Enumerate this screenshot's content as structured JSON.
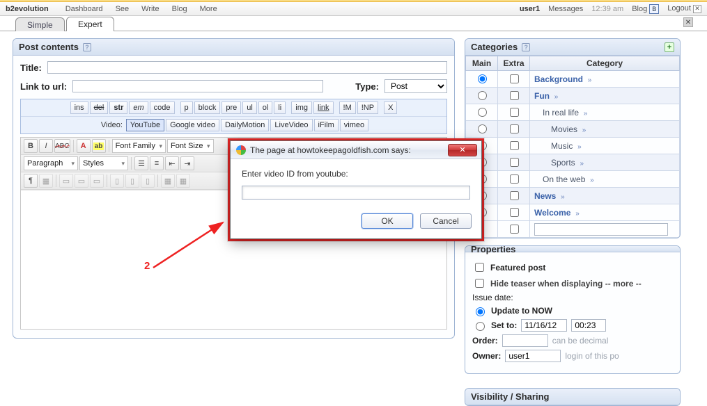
{
  "topbar": {
    "brand": "b2evolution",
    "menus": [
      "Dashboard",
      "See",
      "Write",
      "Blog",
      "More"
    ],
    "user": "user1",
    "messages": "Messages",
    "time": "12:39 am",
    "blog": "Blog",
    "logout": "Logout"
  },
  "tabs": {
    "simple": "Simple",
    "expert": "Expert"
  },
  "post": {
    "panelTitle": "Post contents",
    "titleLabel": "Title:",
    "linkLabel": "Link to url:",
    "typeLabel": "Type:",
    "typeOptions": [
      "Post"
    ],
    "typeValue": "Post",
    "tagRow1": [
      "ins",
      "del",
      "str",
      "em",
      "code",
      "p",
      "block",
      "pre",
      "ul",
      "ol",
      "li",
      "img",
      "link",
      "!M",
      "!NP",
      "X"
    ],
    "videoLabel": "Video:",
    "videoRow": [
      "YouTube",
      "Google video",
      "DailyMotion",
      "LiveVideo",
      "iFilm",
      "vimeo"
    ],
    "rte": {
      "fontFamily": "Font Family",
      "fontSize": "Font Size",
      "paragraph": "Paragraph",
      "styles": "Styles"
    }
  },
  "categories": {
    "title": "Categories",
    "headers": {
      "main": "Main",
      "extra": "Extra",
      "category": "Category"
    },
    "rows": [
      {
        "name": "Background",
        "indent": 0,
        "striped": false,
        "mainChecked": true
      },
      {
        "name": "Fun",
        "indent": 0,
        "striped": true,
        "mainChecked": false
      },
      {
        "name": "In real life",
        "indent": 1,
        "striped": false,
        "mainChecked": false
      },
      {
        "name": "Movies",
        "indent": 2,
        "striped": true,
        "mainChecked": false
      },
      {
        "name": "Music",
        "indent": 2,
        "striped": false,
        "mainChecked": false
      },
      {
        "name": "Sports",
        "indent": 2,
        "striped": true,
        "mainChecked": false
      },
      {
        "name": "On the web",
        "indent": 1,
        "striped": false,
        "mainChecked": false
      },
      {
        "name": "News",
        "indent": 0,
        "striped": true,
        "mainChecked": false
      },
      {
        "name": "Welcome",
        "indent": 0,
        "striped": false,
        "mainChecked": false
      }
    ]
  },
  "properties": {
    "title": "Properties",
    "featured": "Featured post",
    "hide": "Hide teaser when displaying -- more --",
    "issueDate": "Issue date:",
    "updateNow": "Update to NOW",
    "setTo": "Set to:",
    "date": "11/16/12",
    "time": "00:23",
    "orderLabel": "Order:",
    "orderHint": "can be decimal",
    "ownerLabel": "Owner:",
    "ownerValue": "user1",
    "ownerHint": "login of this po"
  },
  "visibility": {
    "title": "Visibility / Sharing"
  },
  "dialog": {
    "title": "The page at howtokeepagoldfish.com says:",
    "prompt": "Enter video ID from youtube:",
    "ok": "OK",
    "cancel": "Cancel"
  },
  "annotation": {
    "label": "2"
  }
}
